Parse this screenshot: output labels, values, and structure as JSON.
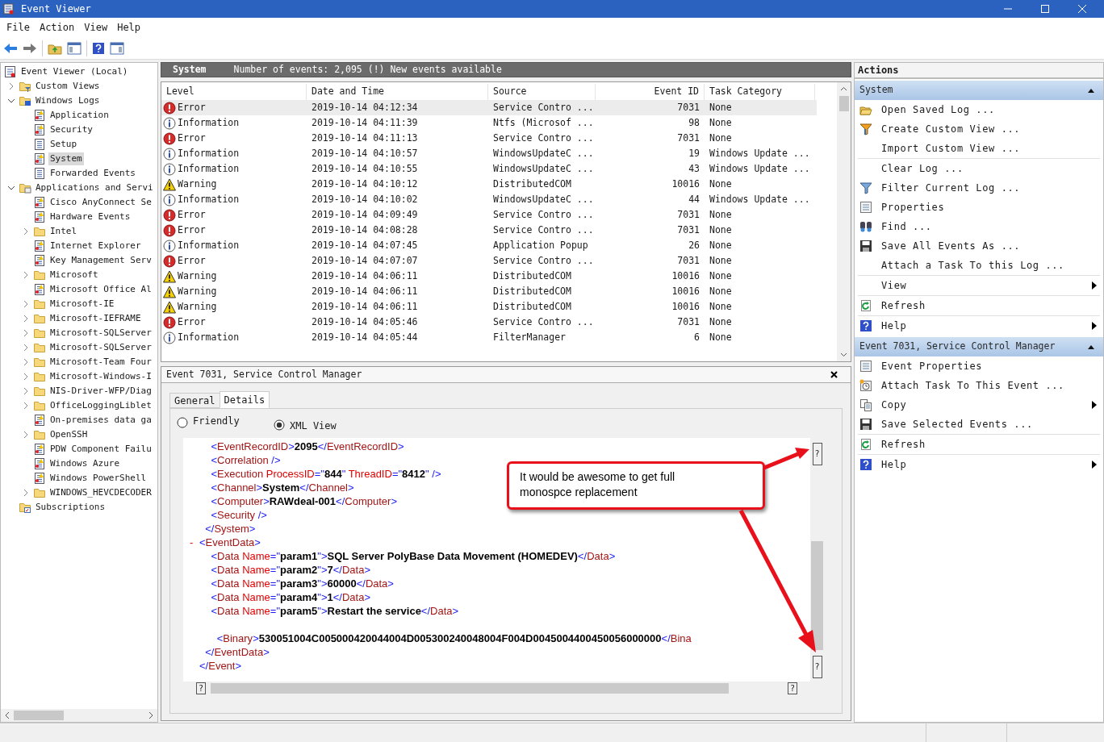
{
  "window": {
    "title": "Event Viewer"
  },
  "menu": [
    "File",
    "Action",
    "View",
    "Help"
  ],
  "tree": [
    {
      "label": "Event Viewer (Local)",
      "kind": "root",
      "selected": false,
      "children": [
        {
          "label": "Custom Views",
          "kind": "custom_views",
          "expanded": false,
          "selected": false
        },
        {
          "label": "Windows Logs",
          "kind": "windows_logs",
          "expanded": true,
          "selected": false,
          "children": [
            {
              "label": "Application",
              "kind": "log_alert",
              "selected": false
            },
            {
              "label": "Security",
              "kind": "log_alert",
              "selected": false
            },
            {
              "label": "Setup",
              "kind": "log",
              "selected": false
            },
            {
              "label": "System",
              "kind": "log_alert",
              "selected": true
            },
            {
              "label": "Forwarded Events",
              "kind": "log",
              "selected": false
            }
          ]
        },
        {
          "label": "Applications and Servi",
          "kind": "apps_folder",
          "expanded": true,
          "selected": false,
          "children": [
            {
              "label": "Cisco AnyConnect Se",
              "kind": "log_alert",
              "selected": false
            },
            {
              "label": "Hardware Events",
              "kind": "log_alert",
              "selected": false
            },
            {
              "label": "Intel",
              "kind": "folder",
              "expanded": false,
              "selected": false
            },
            {
              "label": "Internet Explorer",
              "kind": "log_alert",
              "selected": false
            },
            {
              "label": "Key Management Serv",
              "kind": "log_alert",
              "selected": false
            },
            {
              "label": "Microsoft",
              "kind": "folder",
              "expanded": false,
              "selected": false
            },
            {
              "label": "Microsoft Office Al",
              "kind": "log_alert",
              "selected": false
            },
            {
              "label": "Microsoft-IE",
              "kind": "folder",
              "expanded": false,
              "selected": false
            },
            {
              "label": "Microsoft-IEFRAME",
              "kind": "folder",
              "expanded": false,
              "selected": false
            },
            {
              "label": "Microsoft-SQLServer",
              "kind": "folder",
              "expanded": false,
              "selected": false
            },
            {
              "label": "Microsoft-SQLServer",
              "kind": "folder",
              "expanded": false,
              "selected": false
            },
            {
              "label": "Microsoft-Team Four",
              "kind": "folder",
              "expanded": false,
              "selected": false
            },
            {
              "label": "Microsoft-Windows-I",
              "kind": "folder",
              "expanded": false,
              "selected": false
            },
            {
              "label": "NIS-Driver-WFP/Diag",
              "kind": "folder",
              "expanded": false,
              "selected": false
            },
            {
              "label": "OfficeLoggingLiblet",
              "kind": "folder",
              "expanded": false,
              "selected": false
            },
            {
              "label": "On-premises data ga",
              "kind": "log_alert",
              "selected": false
            },
            {
              "label": "OpenSSH",
              "kind": "folder",
              "expanded": false,
              "selected": false
            },
            {
              "label": "PDW Component Failu",
              "kind": "log_alert",
              "selected": false
            },
            {
              "label": "Windows Azure",
              "kind": "log_alert",
              "selected": false
            },
            {
              "label": "Windows PowerShell",
              "kind": "log_alert",
              "selected": false
            },
            {
              "label": "WINDOWS_HEVCDECODER",
              "kind": "folder",
              "expanded": false,
              "selected": false
            }
          ]
        },
        {
          "label": "Subscriptions",
          "kind": "subscriptions",
          "selected": false
        }
      ]
    }
  ],
  "log_header": {
    "title": "System",
    "info": "Number of events: 2,095 (!) New events available"
  },
  "table": {
    "columns": [
      "Level",
      "Date and Time",
      "Source",
      "Event ID",
      "Task Category"
    ],
    "rows": [
      {
        "kind": "error",
        "level": "Error",
        "date": "2019-10-14 04:12:34",
        "source": "Service Contro ...",
        "event_id": "7031",
        "task_category": "None",
        "selected": true
      },
      {
        "kind": "info",
        "level": "Information",
        "date": "2019-10-14 04:11:39",
        "source": "Ntfs (Microsof ...",
        "event_id": "98",
        "task_category": "None",
        "selected": false
      },
      {
        "kind": "error",
        "level": "Error",
        "date": "2019-10-14 04:11:13",
        "source": "Service Contro ...",
        "event_id": "7031",
        "task_category": "None",
        "selected": false
      },
      {
        "kind": "info",
        "level": "Information",
        "date": "2019-10-14 04:10:57",
        "source": "WindowsUpdateC ...",
        "event_id": "19",
        "task_category": "Windows Update ...",
        "selected": false
      },
      {
        "kind": "info",
        "level": "Information",
        "date": "2019-10-14 04:10:55",
        "source": "WindowsUpdateC ...",
        "event_id": "43",
        "task_category": "Windows Update ...",
        "selected": false
      },
      {
        "kind": "warning",
        "level": "Warning",
        "date": "2019-10-14 04:10:12",
        "source": "DistributedCOM",
        "event_id": "10016",
        "task_category": "None",
        "selected": false
      },
      {
        "kind": "info",
        "level": "Information",
        "date": "2019-10-14 04:10:02",
        "source": "WindowsUpdateC ...",
        "event_id": "44",
        "task_category": "Windows Update ...",
        "selected": false
      },
      {
        "kind": "error",
        "level": "Error",
        "date": "2019-10-14 04:09:49",
        "source": "Service Contro ...",
        "event_id": "7031",
        "task_category": "None",
        "selected": false
      },
      {
        "kind": "error",
        "level": "Error",
        "date": "2019-10-14 04:08:28",
        "source": "Service Contro ...",
        "event_id": "7031",
        "task_category": "None",
        "selected": false
      },
      {
        "kind": "info",
        "level": "Information",
        "date": "2019-10-14 04:07:45",
        "source": "Application Popup",
        "event_id": "26",
        "task_category": "None",
        "selected": false
      },
      {
        "kind": "error",
        "level": "Error",
        "date": "2019-10-14 04:07:07",
        "source": "Service Contro ...",
        "event_id": "7031",
        "task_category": "None",
        "selected": false
      },
      {
        "kind": "warning",
        "level": "Warning",
        "date": "2019-10-14 04:06:11",
        "source": "DistributedCOM",
        "event_id": "10016",
        "task_category": "None",
        "selected": false
      },
      {
        "kind": "warning",
        "level": "Warning",
        "date": "2019-10-14 04:06:11",
        "source": "DistributedCOM",
        "event_id": "10016",
        "task_category": "None",
        "selected": false
      },
      {
        "kind": "warning",
        "level": "Warning",
        "date": "2019-10-14 04:06:11",
        "source": "DistributedCOM",
        "event_id": "10016",
        "task_category": "None",
        "selected": false
      },
      {
        "kind": "error",
        "level": "Error",
        "date": "2019-10-14 04:05:46",
        "source": "Service Contro ...",
        "event_id": "7031",
        "task_category": "None",
        "selected": false
      },
      {
        "kind": "info",
        "level": "Information",
        "date": "2019-10-14 04:05:44",
        "source": "FilterManager",
        "event_id": "6",
        "task_category": "None",
        "selected": false
      }
    ]
  },
  "detail": {
    "title": "Event 7031, Service Control Manager",
    "tabs": [
      {
        "label": "General",
        "selected": false
      },
      {
        "label": "Details",
        "selected": true
      }
    ],
    "views": [
      {
        "label": "Friendly",
        "selected": false
      },
      {
        "label": "XML View",
        "selected": true
      }
    ],
    "xml_lines": [
      {
        "kind": "code",
        "text": "    <EventRecordID>2095</EventRecordID>"
      },
      {
        "kind": "code",
        "text": "    <Correlation />"
      },
      {
        "kind": "code",
        "text": "    <Execution ProcessID=\"844\" ThreadID=\"8412\" />"
      },
      {
        "kind": "code",
        "text": "    <Channel>System</Channel>"
      },
      {
        "kind": "code",
        "text": "    <Computer>RAWdeal-001</Computer>"
      },
      {
        "kind": "code",
        "text": "    <Security />"
      },
      {
        "kind": "code",
        "text": "  </System>"
      },
      {
        "kind": "code",
        "marker": "-",
        "text": "<EventData>"
      },
      {
        "kind": "code",
        "text": "    <Data Name=\"param1\">SQL Server PolyBase Data Movement (HOMEDEV)</Data>"
      },
      {
        "kind": "code",
        "text": "    <Data Name=\"param2\">7</Data>"
      },
      {
        "kind": "code",
        "text": "    <Data Name=\"param3\">60000</Data>"
      },
      {
        "kind": "code",
        "text": "    <Data Name=\"param4\">1</Data>"
      },
      {
        "kind": "code",
        "text": "    <Data Name=\"param5\">Restart the service</Data>"
      },
      {
        "kind": "blank"
      },
      {
        "kind": "code",
        "text": "      <Binary>530051004C005000420044004D005300240048004F004D0045004400450056000000</Bina"
      },
      {
        "kind": "code",
        "text": "  </EventData>"
      },
      {
        "kind": "code",
        "text": "</Event>"
      }
    ],
    "scroll_arrow_glyphs": [
      "?",
      "?",
      "?",
      "?"
    ]
  },
  "annotation": {
    "text": "It would be awesome to get full monospce replacement"
  },
  "actions": {
    "title": "Actions",
    "sections": [
      {
        "title": "System",
        "expanded": true,
        "groups": [
          [
            {
              "label": "Open Saved Log ...",
              "kind": "open",
              "submenu": false
            },
            {
              "label": "Create Custom View ...",
              "kind": "filter_new",
              "submenu": false
            },
            {
              "label": "Import Custom View ...",
              "kind": "plain",
              "submenu": false
            }
          ],
          [
            {
              "label": "Clear Log ...",
              "kind": "plain",
              "submenu": false
            },
            {
              "label": "Filter Current Log ...",
              "kind": "filter",
              "submenu": false
            },
            {
              "label": "Properties",
              "kind": "properties",
              "submenu": false
            },
            {
              "label": "Find ...",
              "kind": "find",
              "submenu": false
            },
            {
              "label": "Save All Events As ...",
              "kind": "save",
              "submenu": false
            },
            {
              "label": "Attach a Task To this Log ...",
              "kind": "plain",
              "submenu": false
            }
          ],
          [
            {
              "label": "View",
              "kind": "plain",
              "submenu": true
            }
          ],
          [
            {
              "label": "Refresh",
              "kind": "refresh",
              "submenu": false
            }
          ],
          [
            {
              "label": "Help",
              "kind": "help",
              "submenu": true
            }
          ]
        ]
      },
      {
        "title": "Event 7031, Service Control Manager",
        "expanded": true,
        "groups": [
          [
            {
              "label": "Event Properties",
              "kind": "properties",
              "submenu": false
            },
            {
              "label": "Attach Task To This Event ...",
              "kind": "task",
              "submenu": false
            },
            {
              "label": "Copy",
              "kind": "copy",
              "submenu": true
            },
            {
              "label": "Save Selected Events ...",
              "kind": "save",
              "submenu": false
            }
          ],
          [
            {
              "label": "Refresh",
              "kind": "refresh",
              "submenu": false
            }
          ],
          [
            {
              "label": "Help",
              "kind": "help",
              "submenu": true
            }
          ]
        ]
      }
    ]
  }
}
